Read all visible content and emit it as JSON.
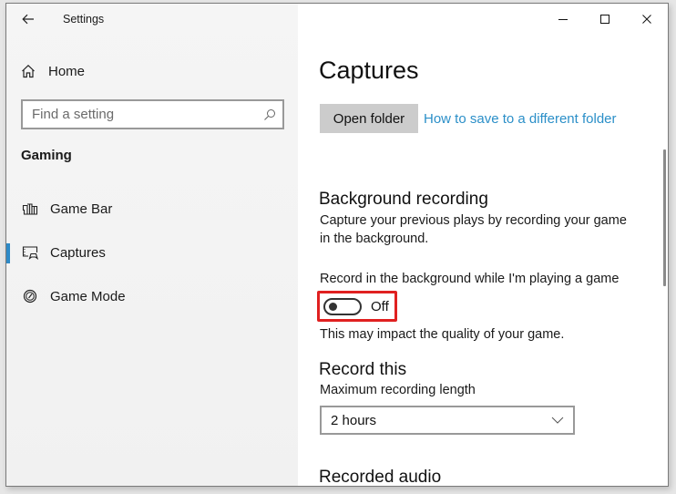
{
  "window": {
    "title": "Settings",
    "controls": {
      "minimize": "minimize-icon",
      "maximize": "maximize-icon",
      "close": "close-icon"
    }
  },
  "sidebar": {
    "home_label": "Home",
    "search_placeholder": "Find a setting",
    "section_label": "Gaming",
    "items": [
      {
        "label": "Game Bar",
        "icon": "game-bar-icon",
        "active": false
      },
      {
        "label": "Captures",
        "icon": "captures-icon",
        "active": true
      },
      {
        "label": "Game Mode",
        "icon": "game-mode-icon",
        "active": false
      }
    ],
    "accent_color": "#2e8ac7"
  },
  "main": {
    "page_title": "Captures",
    "open_folder_label": "Open folder",
    "save_link_label": "How to save to a different folder",
    "background_recording": {
      "heading": "Background recording",
      "description_line1": "Capture your previous plays by recording your game",
      "description_line2": "in the background.",
      "toggle_label": "Record in the background while I'm playing a game",
      "toggle_state": "Off",
      "toggle_on": false,
      "note": "This may impact the quality of your game."
    },
    "record_this": {
      "heading": "Record this",
      "max_length_label": "Maximum recording length",
      "max_length_value": "2 hours"
    },
    "recorded_audio": {
      "heading": "Recorded audio"
    },
    "link_color": "#2b8fc8",
    "highlight_color": "#e02020"
  }
}
